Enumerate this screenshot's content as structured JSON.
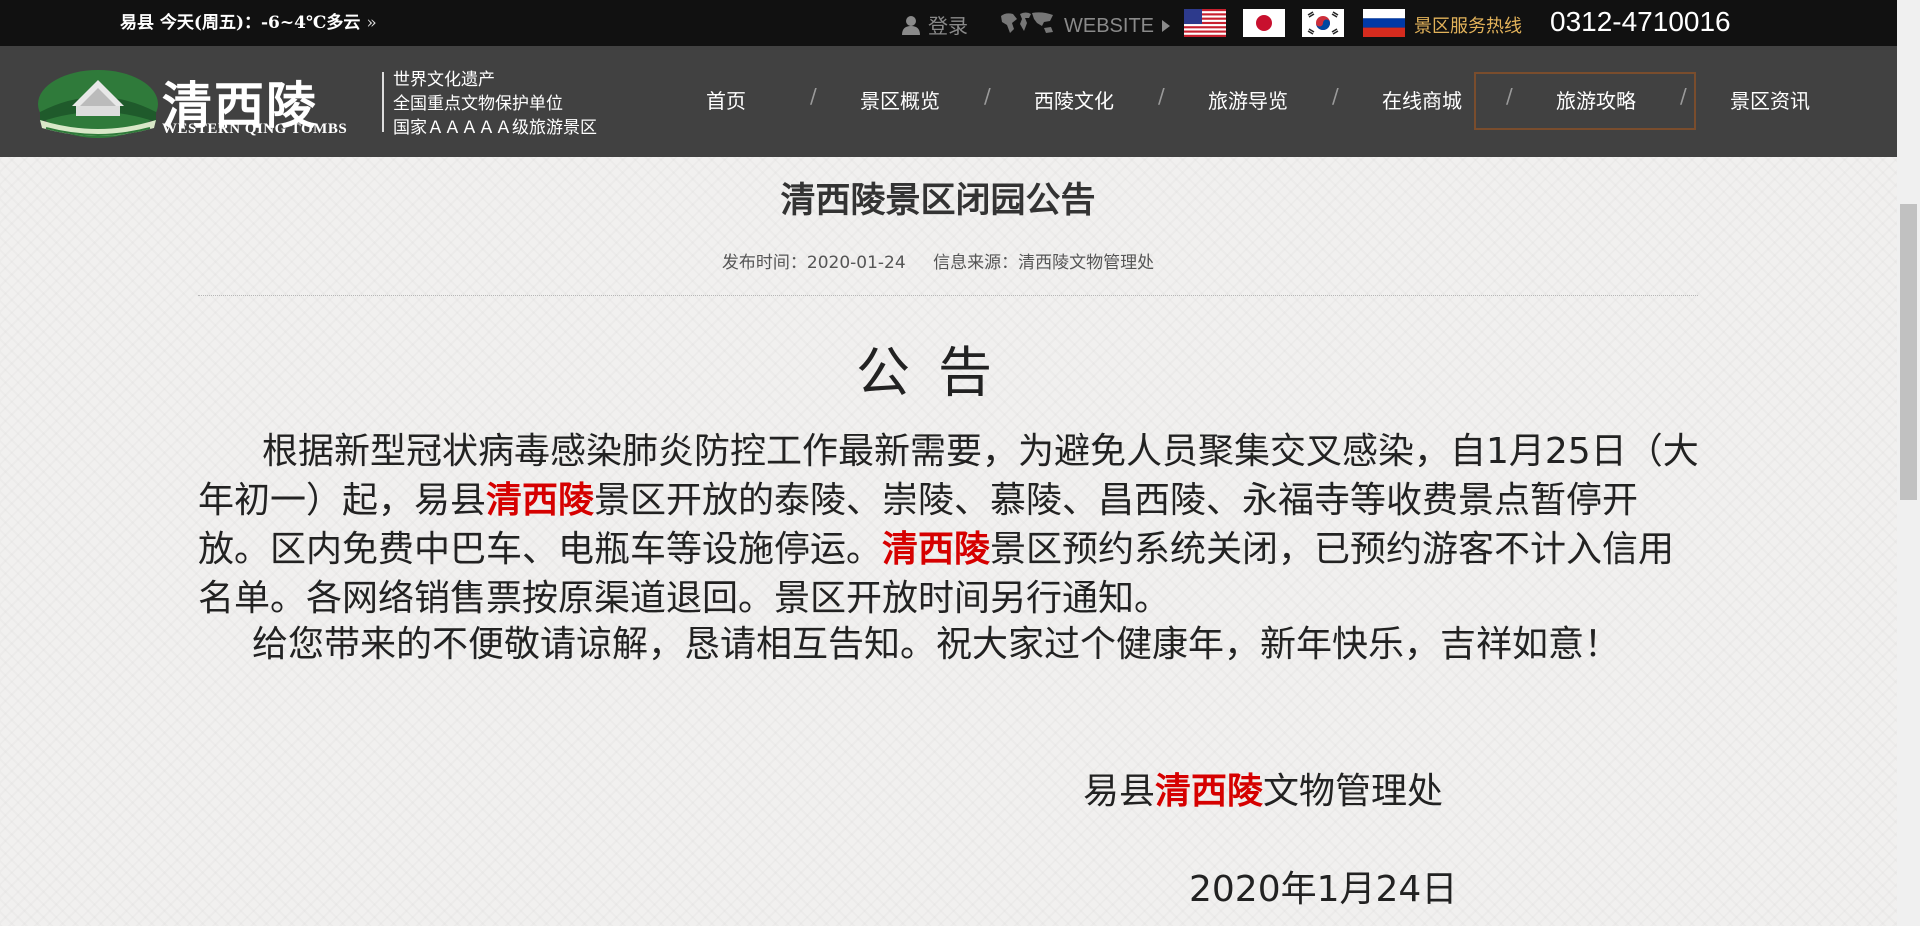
{
  "topbar": {
    "weather": "易县   今天(周五)：-6~4℃多云",
    "weather_more": "»",
    "login": "登录",
    "website": "WEBSITE",
    "hotline_label": "景区服务热线",
    "hotline": "0312-4710016",
    "flags": [
      "us-flag",
      "japan-flag",
      "korea-flag",
      "russia-flag"
    ]
  },
  "logo": {
    "cn": "清西陵",
    "en": "WESTERN QING TOMBS",
    "titles": [
      "世界文化遗产",
      "全国重点文物保护单位",
      "国家ＡＡＡＡＡ级旅游景区"
    ]
  },
  "nav": {
    "items": [
      "首页",
      "景区概览",
      "西陵文化",
      "旅游导览",
      "在线商城",
      "旅游攻略",
      "景区资讯"
    ],
    "active": "旅游攻略",
    "separator": "/"
  },
  "article": {
    "title": "清西陵景区闭园公告",
    "publish_label": "发布时间：",
    "publish_date": "2020-01-24",
    "source_label": "信息来源：",
    "source": "清西陵文物管理处",
    "heading": "公告",
    "p1_a": "根据新型冠状病毒感染肺炎防控工作最新需要，为避免人员聚集交叉感染，自1月25日（大年初一）起，易县",
    "p1_hl1": "清西陵",
    "p1_b": "景区开放的泰陵、崇陵、慕陵、昌西陵、永福寺等收费景点暂停开放。区内免费中巴车、电瓶车等设施停运。",
    "p1_hl2": "清西陵",
    "p1_c": "景区预约系统关闭，已预约游客不计入信用名单。各网络销售票按原渠道退回。景区开放时间另行通知。",
    "p2": "给您带来的不便敬请谅解，恳请相互告知。祝大家过个健康年，新年快乐，吉祥如意！",
    "sign_a": "易县",
    "sign_hl": "清西陵",
    "sign_b": "文物管理处",
    "date": "2020年1月24日"
  },
  "colors": {
    "topbar_bg": "#111111",
    "nav_bg": "#414141",
    "hotline_label": "#e2b25a",
    "highlight": "#d60000",
    "active_border": "#7a4d2d"
  }
}
